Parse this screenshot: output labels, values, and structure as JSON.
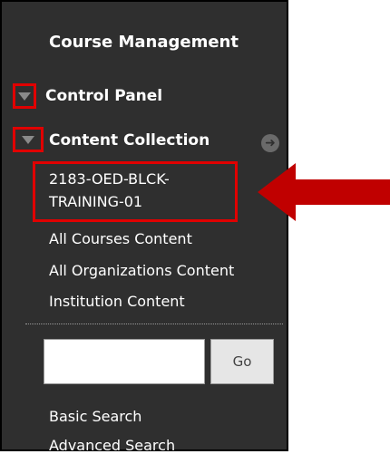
{
  "panel": {
    "title": "Course Management",
    "sections": [
      {
        "label": "Control Panel"
      },
      {
        "label": "Content Collection"
      }
    ],
    "links": [
      {
        "label": "2183-OED-BLCK-\nTRAINING-01"
      },
      {
        "label": "All Courses Content"
      },
      {
        "label": "All Organizations Content"
      },
      {
        "label": "Institution Content"
      }
    ],
    "search": {
      "placeholder": "",
      "value": "",
      "go_label": "Go"
    },
    "search_links": [
      {
        "label": "Basic Search"
      },
      {
        "label": "Advanced Search"
      }
    ]
  },
  "colors": {
    "panel_bg": "#2f2f2f",
    "highlight": "#e10000",
    "arrow": "#c00000"
  },
  "icons": {
    "section_toggle": "triangle-down-icon",
    "section_go": "arrow-right-circle-icon",
    "annotation": "arrow-left-icon"
  }
}
